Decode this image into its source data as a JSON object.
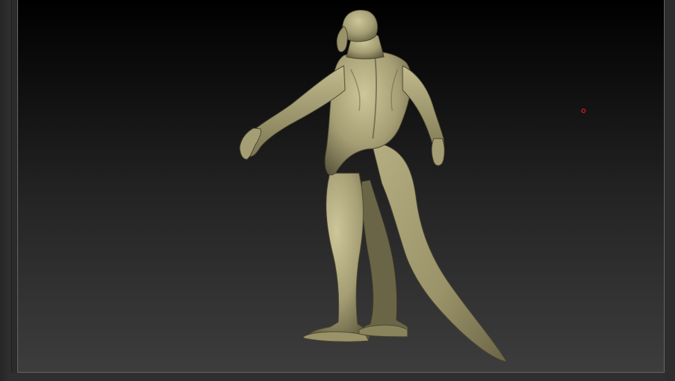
{
  "viewport": {
    "background_top": "#000000",
    "background_bottom": "#3d3d3d",
    "frame_color": "#6a6a6a"
  },
  "model": {
    "material_color": "#a59e74",
    "shadow_color": "#4e4a33",
    "highlight_color": "#cdc69a"
  },
  "cursor": {
    "icon": "brush-cursor-icon",
    "color": "#d01818"
  }
}
